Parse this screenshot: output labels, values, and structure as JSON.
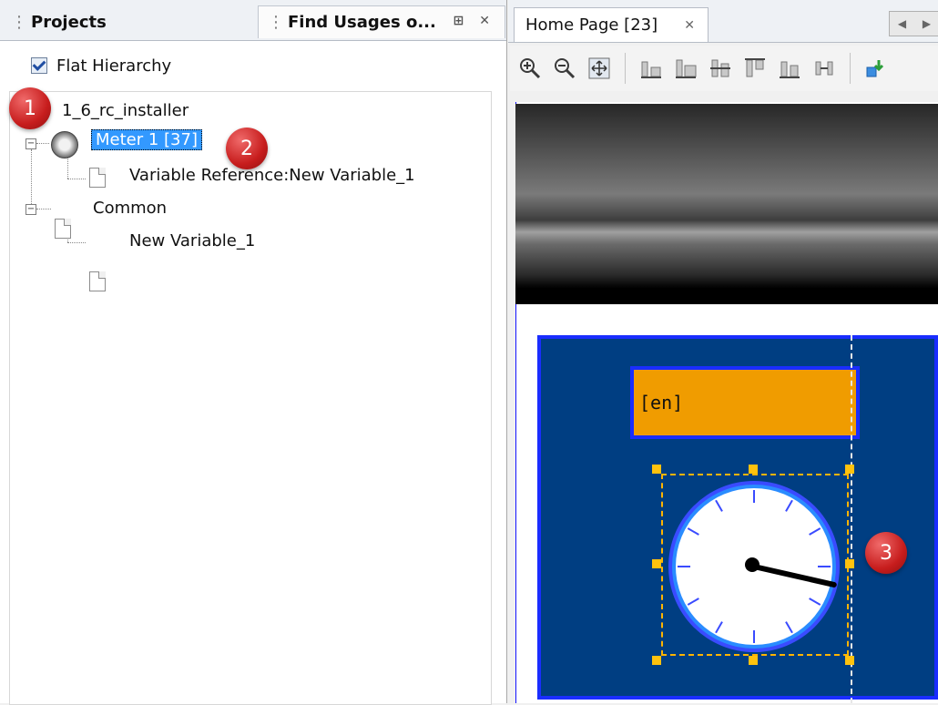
{
  "left_panel": {
    "tabs": [
      {
        "label": "Projects"
      },
      {
        "label": "Find Usages o..."
      }
    ],
    "find_tab_icons": "⊞ ✕",
    "flat_hierarchy": {
      "label": "Flat Hierarchy",
      "checked": true
    },
    "tree": {
      "root": "1_6_rc_installer",
      "meter": "Meter 1 [37]",
      "var_ref": "Variable Reference:New Variable_1",
      "common": "Common",
      "new_var": "New Variable_1",
      "expander_symbol": "−"
    }
  },
  "right_panel": {
    "tab": {
      "label": "Home Page [23]",
      "close": "✕"
    },
    "nav": {
      "prev": "◀",
      "next": "▶"
    },
    "toolbar": [
      "zoom-in-icon",
      "zoom-out-icon",
      "fit-icon",
      "align-bottom-icon",
      "align-left-icon",
      "align-center-icon",
      "align-top-icon",
      "align-right-icon",
      "distribute-icon",
      "import-icon"
    ],
    "lang_placeholder": "[en]",
    "meter_needle_value_fraction": 0.27
  },
  "badges": [
    "1",
    "2",
    "3"
  ],
  "colors": {
    "widget_bg": "#003e82",
    "border_blue": "#1a2dff",
    "lang_box": "#f09c00",
    "selection": "#3399ff",
    "handle": "#ffc20e",
    "badge_red": "#c71d1d"
  }
}
